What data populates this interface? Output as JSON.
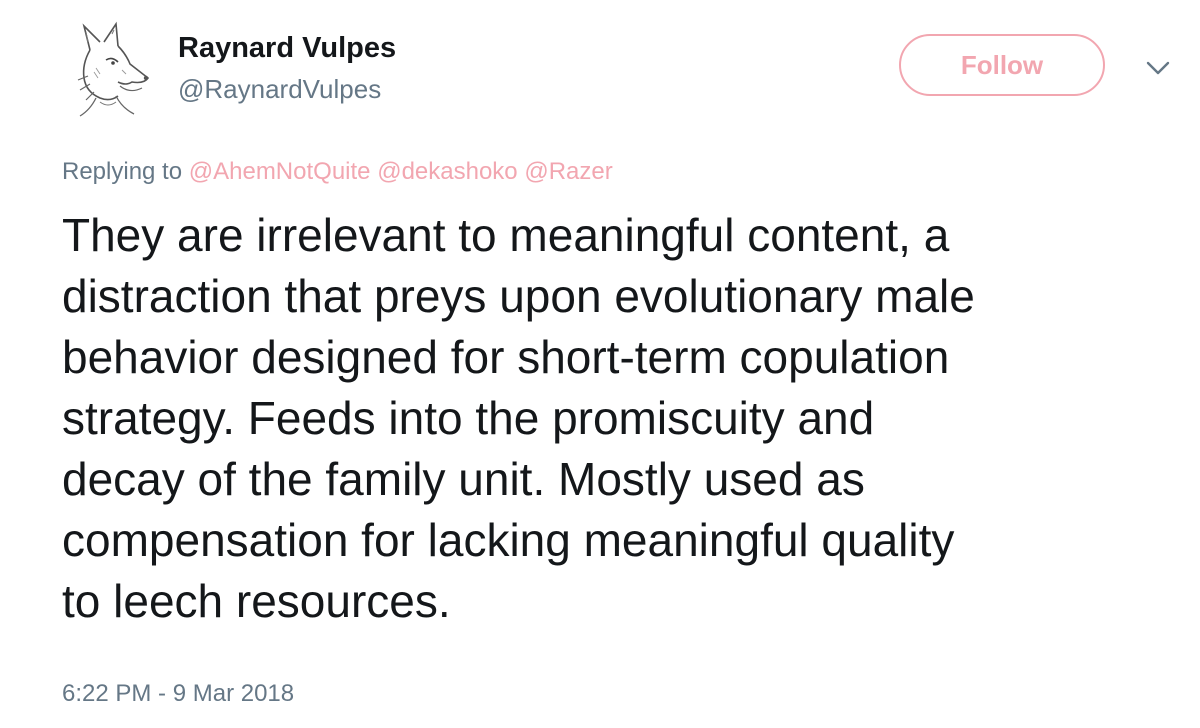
{
  "author": {
    "name": "Raynard Vulpes",
    "handle": "@RaynardVulpes",
    "avatar_icon": "fox-sketch-avatar"
  },
  "actions": {
    "follow_label": "Follow",
    "follow_color": "#f2a6b0",
    "menu_icon": "chevron-down-icon"
  },
  "reply": {
    "prefix": "Replying to",
    "mentions": [
      "@AhemNotQuite",
      "@dekashoko",
      "@Razer"
    ]
  },
  "tweet": {
    "lines": [
      "They are irrelevant to meaningful content, a",
      "distraction that preys upon evolutionary male",
      "behavior designed for short-term copulation",
      "strategy. Feeds into the promiscuity and",
      "decay of the family unit. Mostly used as",
      "compensation for lacking meaningful quality",
      "to leech resources."
    ]
  },
  "timestamp": "6:22 PM - 9 Mar 2018",
  "colors": {
    "text": "#14171a",
    "secondary": "#657786",
    "accent": "#f2a6b0"
  }
}
